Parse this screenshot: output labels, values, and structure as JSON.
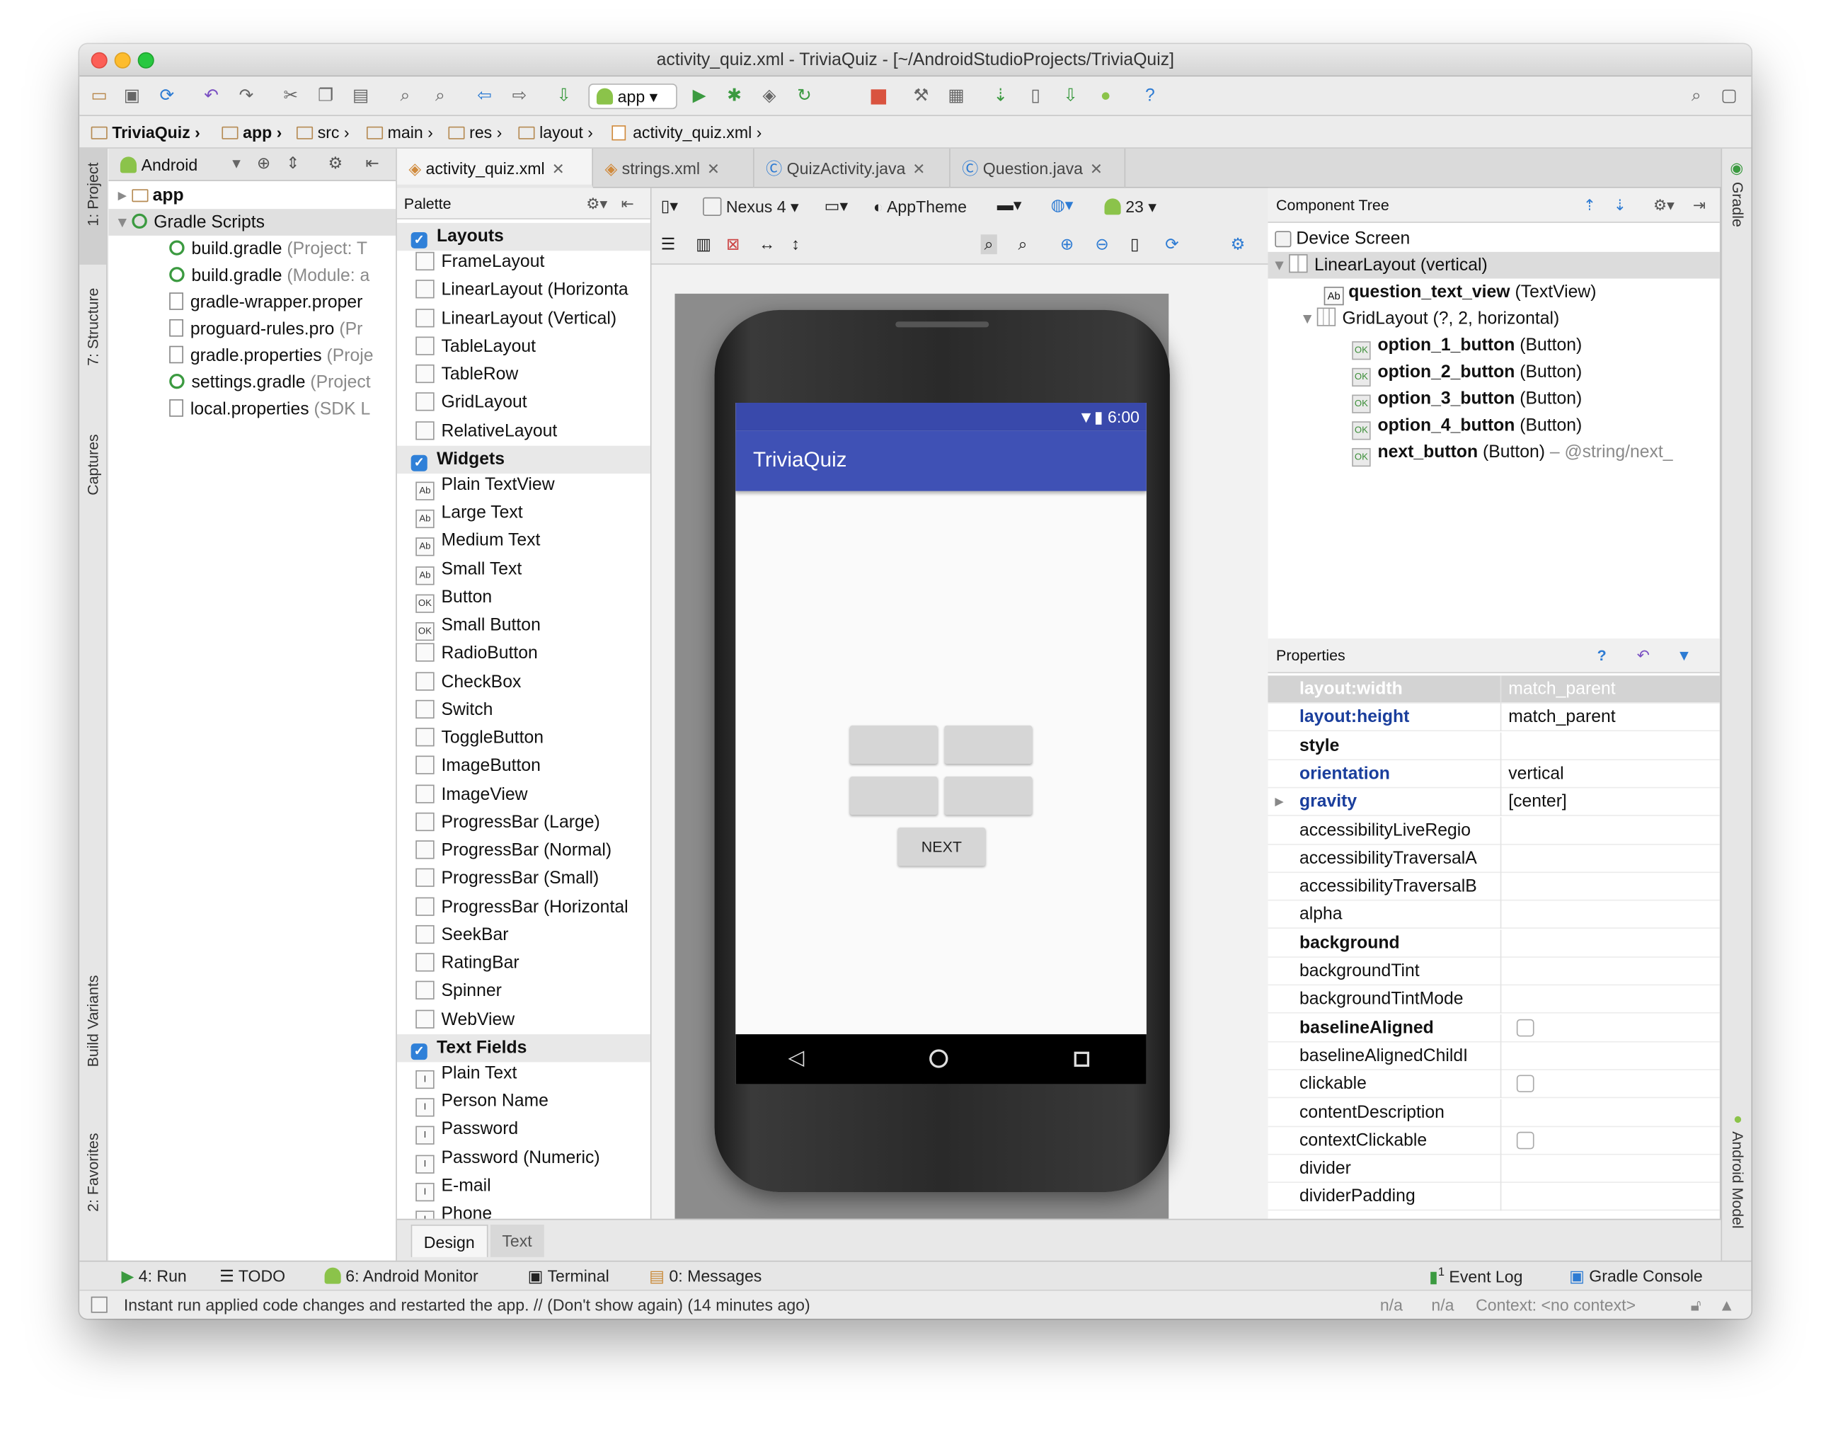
{
  "window": {
    "title": "activity_quiz.xml - TriviaQuiz - [~/AndroidStudioProjects/TriviaQuiz]"
  },
  "toolbar": {
    "run_config": "app"
  },
  "breadcrumbs": [
    "TriviaQuiz",
    "app",
    "src",
    "main",
    "res",
    "layout",
    "activity_quiz.xml"
  ],
  "left_tool_windows": [
    "1: Project",
    "7: Structure",
    "Captures",
    "Build Variants",
    "2: Favorites"
  ],
  "right_tool_windows": [
    "Gradle",
    "Android Model"
  ],
  "project": {
    "view_mode": "Android",
    "tree": [
      {
        "name": "app",
        "hint": ""
      },
      {
        "name": "Gradle Scripts",
        "hint": ""
      },
      {
        "name": "build.gradle",
        "hint": "(Project: T"
      },
      {
        "name": "build.gradle",
        "hint": "(Module: a"
      },
      {
        "name": "gradle-wrapper.proper",
        "hint": ""
      },
      {
        "name": "proguard-rules.pro",
        "hint": "(Pr"
      },
      {
        "name": "gradle.properties",
        "hint": "(Proje"
      },
      {
        "name": "settings.gradle",
        "hint": "(Project"
      },
      {
        "name": "local.properties",
        "hint": "(SDK L"
      }
    ]
  },
  "editor_tabs": [
    "activity_quiz.xml",
    "strings.xml",
    "QuizActivity.java",
    "Question.java"
  ],
  "palette": {
    "title": "Palette",
    "items": [
      {
        "label": "Layouts",
        "cat": true,
        "icon": ""
      },
      {
        "label": "FrameLayout",
        "icon": ""
      },
      {
        "label": "LinearLayout (Horizonta",
        "icon": ""
      },
      {
        "label": "LinearLayout (Vertical)",
        "icon": ""
      },
      {
        "label": "TableLayout",
        "icon": ""
      },
      {
        "label": "TableRow",
        "icon": ""
      },
      {
        "label": "GridLayout",
        "icon": ""
      },
      {
        "label": "RelativeLayout",
        "icon": ""
      },
      {
        "label": "Widgets",
        "cat": true,
        "icon": ""
      },
      {
        "label": "Plain TextView",
        "icon": "Ab"
      },
      {
        "label": "Large Text",
        "icon": "Ab"
      },
      {
        "label": "Medium Text",
        "icon": "Ab"
      },
      {
        "label": "Small Text",
        "icon": "Ab"
      },
      {
        "label": "Button",
        "icon": "OK"
      },
      {
        "label": "Small Button",
        "icon": "OK"
      },
      {
        "label": "RadioButton",
        "icon": ""
      },
      {
        "label": "CheckBox",
        "icon": ""
      },
      {
        "label": "Switch",
        "icon": ""
      },
      {
        "label": "ToggleButton",
        "icon": ""
      },
      {
        "label": "ImageButton",
        "icon": ""
      },
      {
        "label": "ImageView",
        "icon": ""
      },
      {
        "label": "ProgressBar (Large)",
        "icon": ""
      },
      {
        "label": "ProgressBar (Normal)",
        "icon": ""
      },
      {
        "label": "ProgressBar (Small)",
        "icon": ""
      },
      {
        "label": "ProgressBar (Horizontal",
        "icon": ""
      },
      {
        "label": "SeekBar",
        "icon": ""
      },
      {
        "label": "RatingBar",
        "icon": ""
      },
      {
        "label": "Spinner",
        "icon": ""
      },
      {
        "label": "WebView",
        "icon": ""
      },
      {
        "label": "Text Fields",
        "cat": true,
        "icon": ""
      },
      {
        "label": "Plain Text",
        "icon": "I"
      },
      {
        "label": "Person Name",
        "icon": "I"
      },
      {
        "label": "Password",
        "icon": "I"
      },
      {
        "label": "Password (Numeric)",
        "icon": "I"
      },
      {
        "label": "E-mail",
        "icon": "I"
      },
      {
        "label": "Phone",
        "icon": "I"
      }
    ]
  },
  "canvas_toolbar": {
    "device": "Nexus 4",
    "theme": "AppTheme",
    "api": "23"
  },
  "device_preview": {
    "time": "6:00",
    "app_title": "TriviaQuiz",
    "next_button": "NEXT"
  },
  "component_tree": {
    "title": "Component Tree",
    "rows": [
      {
        "name": "Device Screen",
        "type": "",
        "extra": ""
      },
      {
        "name": "LinearLayout",
        "type": "(vertical)",
        "extra": ""
      },
      {
        "name": "question_text_view",
        "type": "(TextView)",
        "extra": ""
      },
      {
        "name": "GridLayout",
        "type": "(?, 2, horizontal)",
        "extra": ""
      },
      {
        "name": "option_1_button",
        "type": "(Button)",
        "extra": ""
      },
      {
        "name": "option_2_button",
        "type": "(Button)",
        "extra": ""
      },
      {
        "name": "option_3_button",
        "type": "(Button)",
        "extra": ""
      },
      {
        "name": "option_4_button",
        "type": "(Button)",
        "extra": ""
      },
      {
        "name": "next_button",
        "type": "(Button)",
        "extra": " – @string/next_"
      }
    ]
  },
  "properties": {
    "title": "Properties",
    "rows": [
      {
        "name": "layout:width",
        "value": "match_parent"
      },
      {
        "name": "layout:height",
        "value": "match_parent"
      },
      {
        "name": "style",
        "value": ""
      },
      {
        "name": "orientation",
        "value": "vertical"
      },
      {
        "name": "gravity",
        "value": "[center]"
      },
      {
        "name": "accessibilityLiveRegio",
        "value": ""
      },
      {
        "name": "accessibilityTraversalA",
        "value": ""
      },
      {
        "name": "accessibilityTraversalB",
        "value": ""
      },
      {
        "name": "alpha",
        "value": ""
      },
      {
        "name": "background",
        "value": ""
      },
      {
        "name": "backgroundTint",
        "value": ""
      },
      {
        "name": "backgroundTintMode",
        "value": ""
      },
      {
        "name": "baselineAligned",
        "value": ""
      },
      {
        "name": "baselineAlignedChildI",
        "value": ""
      },
      {
        "name": "clickable",
        "value": ""
      },
      {
        "name": "contentDescription",
        "value": ""
      },
      {
        "name": "contextClickable",
        "value": ""
      },
      {
        "name": "divider",
        "value": ""
      },
      {
        "name": "dividerPadding",
        "value": ""
      }
    ]
  },
  "editor_mode_tabs": [
    "Design",
    "Text"
  ],
  "bottom_tools": {
    "run": "4: Run",
    "todo": "TODO",
    "monitor": "6: Android Monitor",
    "terminal": "Terminal",
    "messages": "0: Messages",
    "event_log": "Event Log",
    "event_badge": "1",
    "gradle_console": "Gradle Console"
  },
  "status": {
    "message": "Instant run applied code changes and restarted the app. // (Don't show again) (14 minutes ago)",
    "na1": "n/a",
    "na2": "n/a",
    "context": "Context: <no context>"
  },
  "colors": {
    "app_bar": "#3f51b5",
    "status_bar": "#3949ab",
    "accent_blue": "#2f80d8"
  }
}
